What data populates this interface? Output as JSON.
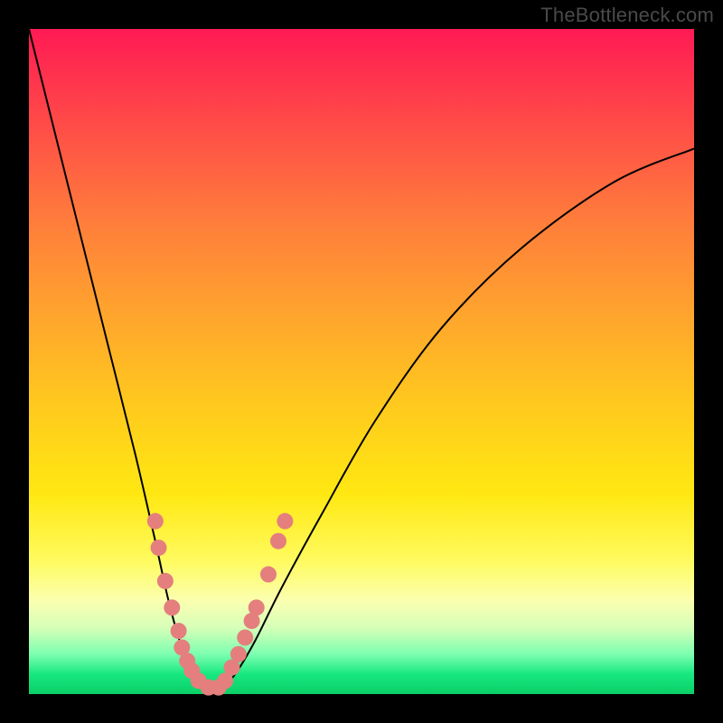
{
  "watermark": "TheBottleneck.com",
  "chart_data": {
    "type": "line",
    "title": "",
    "xlabel": "",
    "ylabel": "",
    "xlim": [
      0,
      100
    ],
    "ylim": [
      0,
      100
    ],
    "grid": false,
    "legend": false,
    "series": [
      {
        "name": "bottleneck-curve",
        "x": [
          0,
          4,
          8,
          12,
          16,
          19,
          21,
          23,
          25,
          27,
          29,
          31,
          34,
          38,
          44,
          52,
          62,
          74,
          88,
          100
        ],
        "y": [
          100,
          84,
          68,
          52,
          36,
          23,
          14,
          7,
          3,
          1,
          1,
          3,
          8,
          16,
          27,
          41,
          55,
          67,
          77,
          82
        ],
        "color": "#000000",
        "stroke_width": 2
      }
    ],
    "scatter": {
      "name": "highlight-dots",
      "color": "#e47f7e",
      "radius": 9,
      "points": [
        {
          "x": 19.0,
          "y": 26.0
        },
        {
          "x": 19.5,
          "y": 22.0
        },
        {
          "x": 20.5,
          "y": 17.0
        },
        {
          "x": 21.5,
          "y": 13.0
        },
        {
          "x": 22.5,
          "y": 9.5
        },
        {
          "x": 23.0,
          "y": 7.0
        },
        {
          "x": 23.8,
          "y": 5.0
        },
        {
          "x": 24.5,
          "y": 3.5
        },
        {
          "x": 25.5,
          "y": 2.0
        },
        {
          "x": 27.0,
          "y": 1.0
        },
        {
          "x": 28.5,
          "y": 1.0
        },
        {
          "x": 29.5,
          "y": 2.0
        },
        {
          "x": 30.5,
          "y": 4.0
        },
        {
          "x": 31.5,
          "y": 6.0
        },
        {
          "x": 32.5,
          "y": 8.5
        },
        {
          "x": 33.5,
          "y": 11.0
        },
        {
          "x": 34.2,
          "y": 13.0
        },
        {
          "x": 36.0,
          "y": 18.0
        },
        {
          "x": 37.5,
          "y": 23.0
        },
        {
          "x": 38.5,
          "y": 26.0
        }
      ]
    }
  }
}
